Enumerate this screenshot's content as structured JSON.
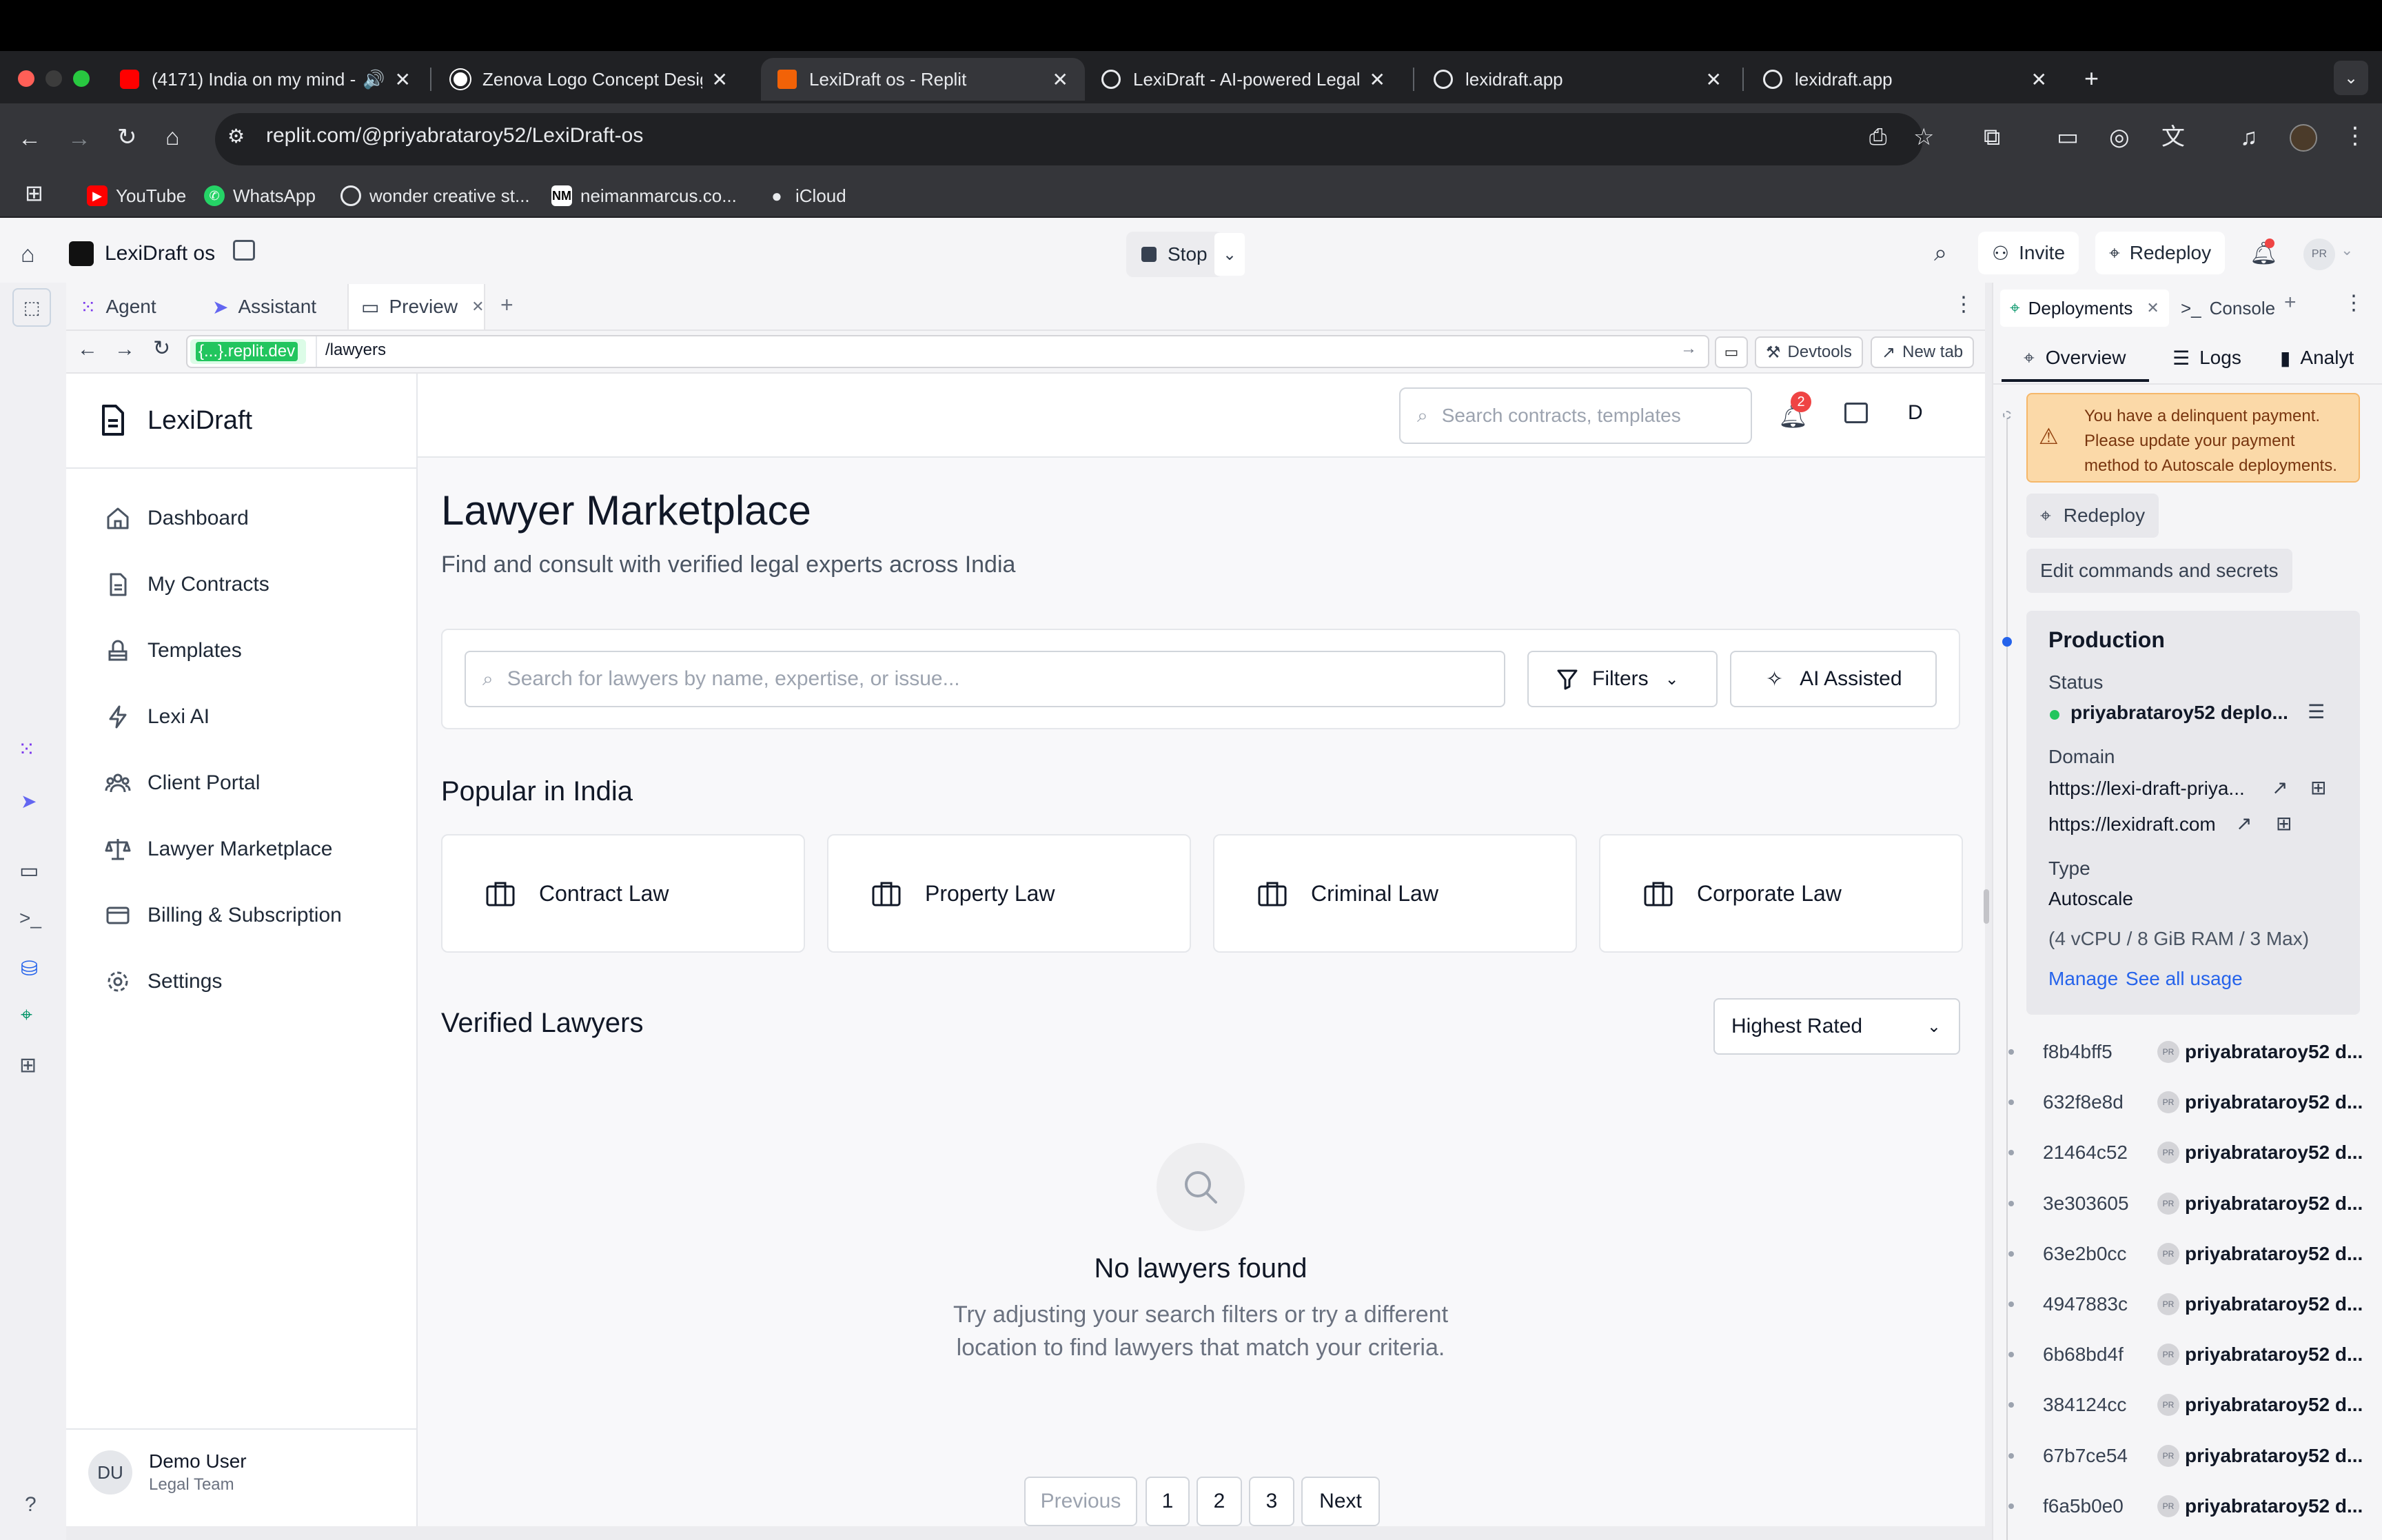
{
  "browser": {
    "tabs": [
      {
        "title": "(4171) India on my mind -",
        "favicon": "youtube-icon",
        "audio": true
      },
      {
        "title": "Zenova Logo Concept Design",
        "favicon": "openai-icon"
      },
      {
        "title": "LexiDraft os - Replit",
        "favicon": "replit-icon",
        "active": true
      },
      {
        "title": "LexiDraft - AI-powered Legal",
        "favicon": "globe-icon"
      },
      {
        "title": "lexidraft.app",
        "favicon": "globe-icon"
      },
      {
        "title": "lexidraft.app",
        "favicon": "globe-icon"
      }
    ],
    "address": "replit.com/@priyabrataroy52/LexiDraft-os",
    "bookmarks": [
      "YouTube",
      "WhatsApp",
      "wonder creative st...",
      "neimanmarcus.co...",
      "iCloud"
    ]
  },
  "replit": {
    "project_name": "LexiDraft os",
    "stop_label": "Stop",
    "invite_label": "Invite",
    "redeploy_label": "Redeploy",
    "avatar_initials": "PR",
    "pane_tabs": [
      "Agent",
      "Assistant",
      "Preview"
    ],
    "preview_domain": "{...}.replit.dev",
    "preview_path": "/lawyers",
    "devtools_label": "Devtools",
    "newtab_label": "New tab"
  },
  "app": {
    "brand": "LexiDraft",
    "search_placeholder": "Search contracts, templates",
    "notification_count": "2",
    "user_initial": "D",
    "nav": [
      "Dashboard",
      "My Contracts",
      "Templates",
      "Lexi AI",
      "Client Portal",
      "Lawyer Marketplace",
      "Billing & Subscription",
      "Settings"
    ],
    "page_title": "Lawyer Marketplace",
    "page_subtitle": "Find and consult with verified legal experts across India",
    "lawyer_search_placeholder": "Search for lawyers by name, expertise, or issue...",
    "filters_label": "Filters",
    "ai_label": "AI Assisted",
    "popular_heading": "Popular in India",
    "categories": [
      "Contract Law",
      "Property Law",
      "Criminal Law",
      "Corporate Law"
    ],
    "verified_heading": "Verified Lawyers",
    "sort_selected": "Highest Rated",
    "empty_title": "No lawyers found",
    "empty_line1": "Try adjusting your search filters or try a different",
    "empty_line2": "location to find lawyers that match your criteria.",
    "pagination": {
      "prev": "Previous",
      "pages": [
        "1",
        "2",
        "3"
      ],
      "next": "Next"
    },
    "user": {
      "initials": "DU",
      "name": "Demo User",
      "team": "Legal Team"
    }
  },
  "deployments": {
    "tab_label": "Deployments",
    "console_label": "Console",
    "subtabs": [
      "Overview",
      "Logs",
      "Analyt"
    ],
    "warning_line1": "You have a delinquent payment.",
    "warning_line2": "Please update your payment",
    "warning_line3": "method to Autoscale deployments.",
    "redeploy_label": "Redeploy",
    "edit_label": "Edit commands and secrets",
    "production_title": "Production",
    "status_label": "Status",
    "status_value": "priyabrataroy52 deplo...",
    "domain_label": "Domain",
    "domain1": "https://lexi-draft-priya...",
    "domain2": "https://lexidraft.com",
    "type_label": "Type",
    "type_value": "Autoscale",
    "type_specs": "(4 vCPU / 8 GiB RAM / 3 Max)",
    "manage_label": "Manage",
    "usage_label": "See all usage",
    "history": [
      {
        "hash": "f8b4bff5",
        "user": "priyabrataroy52 d..."
      },
      {
        "hash": "632f8e8d",
        "user": "priyabrataroy52 d..."
      },
      {
        "hash": "21464c52",
        "user": "priyabrataroy52 d..."
      },
      {
        "hash": "3e303605",
        "user": "priyabrataroy52 d..."
      },
      {
        "hash": "63e2b0cc",
        "user": "priyabrataroy52 d..."
      },
      {
        "hash": "4947883c",
        "user": "priyabrataroy52 d..."
      },
      {
        "hash": "6b68bd4f",
        "user": "priyabrataroy52 d..."
      },
      {
        "hash": "384124cc",
        "user": "priyabrataroy52 d..."
      },
      {
        "hash": "67b7ce54",
        "user": "priyabrataroy52 d..."
      },
      {
        "hash": "f6a5b0e0",
        "user": "priyabrataroy52 d..."
      }
    ]
  },
  "colors": {
    "accent": "#2563eb",
    "warning_bg": "#fbd9a8",
    "notification": "#ef4444"
  }
}
